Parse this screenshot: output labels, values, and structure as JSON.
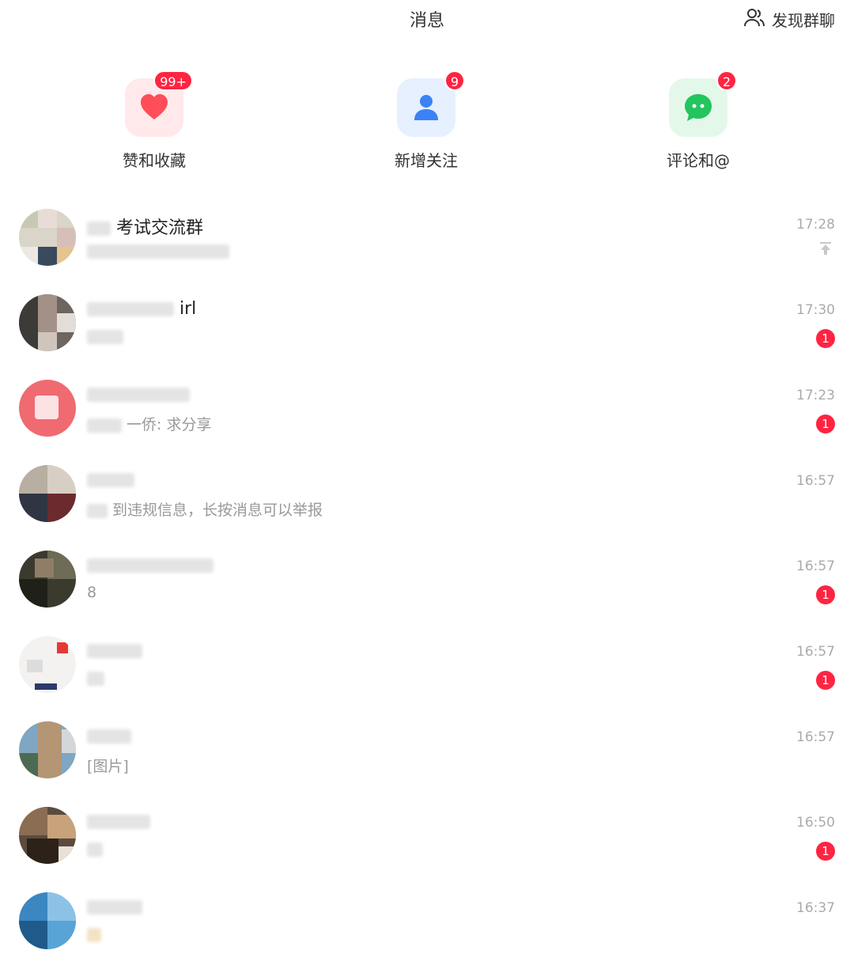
{
  "header": {
    "title": "消息",
    "discover_label": "发现群聊"
  },
  "quick_entries": [
    {
      "label": "赞和收藏",
      "badge": "99+",
      "icon": "heart-icon",
      "color": "#ff4d5a"
    },
    {
      "label": "新增关注",
      "badge": "9",
      "icon": "person-icon",
      "color": "#3b82f6"
    },
    {
      "label": "评论和@",
      "badge": "2",
      "icon": "chat-bubble-icon",
      "color": "#22c55e"
    }
  ],
  "conversations": [
    {
      "name_visible": "考试交流群",
      "preview_visible": "",
      "time": "17:28",
      "pinned": true,
      "unread": ""
    },
    {
      "name_visible": "irl",
      "preview_visible": "",
      "time": "17:30",
      "pinned": false,
      "unread": "1"
    },
    {
      "name_visible": "",
      "preview_visible": "一侨: 求分享",
      "time": "17:23",
      "pinned": false,
      "unread": "1"
    },
    {
      "name_visible": "",
      "preview_visible": "到违规信息，长按消息可以举报",
      "time": "16:57",
      "pinned": false,
      "unread": ""
    },
    {
      "name_visible": "",
      "preview_visible": "8",
      "time": "16:57",
      "pinned": false,
      "unread": "1"
    },
    {
      "name_visible": "",
      "preview_visible": "",
      "time": "16:57",
      "pinned": false,
      "unread": "1"
    },
    {
      "name_visible": "",
      "preview_visible": "[图片]",
      "time": "16:57",
      "pinned": false,
      "unread": ""
    },
    {
      "name_visible": "",
      "preview_visible": "",
      "time": "16:50",
      "pinned": false,
      "unread": "1"
    },
    {
      "name_visible": "",
      "preview_visible": "",
      "time": "16:37",
      "pinned": false,
      "unread": ""
    }
  ],
  "colors": {
    "badge": "#ff2442",
    "text_primary": "#222222",
    "text_secondary": "#999999",
    "time": "#aaaaaa"
  }
}
